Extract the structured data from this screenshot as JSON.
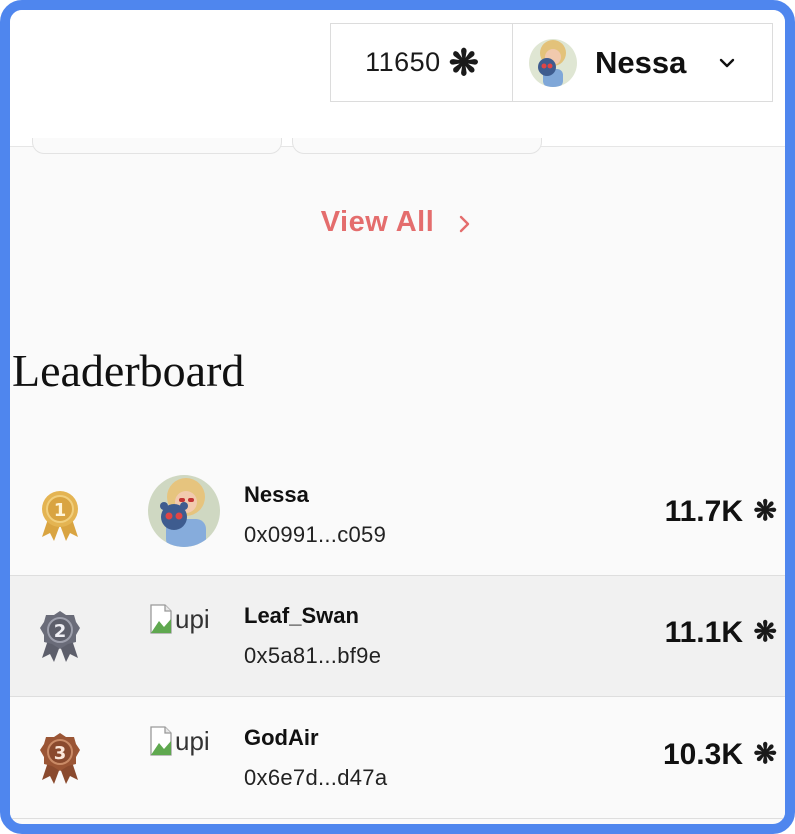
{
  "header": {
    "points": "11650",
    "points_icon": "asterisk-flower-icon",
    "user_name": "Nessa",
    "dropdown_icon": "chevron-down-icon"
  },
  "view_all": {
    "label": "View All",
    "icon": "chevron-right-icon",
    "color": "#e46d6d"
  },
  "leaderboard": {
    "title": "Leaderboard",
    "rows": [
      {
        "rank_icon": "gold-medal-1-icon",
        "name": "Nessa",
        "address": "0x0991...c059",
        "score": "11.7K",
        "avatar": "photo-avatar"
      },
      {
        "rank_icon": "silver-medal-2-icon",
        "name": "Leaf_Swan",
        "address": "0x5a81...bf9e",
        "score": "11.1K",
        "avatar": "broken-image",
        "avatar_alt": "upi"
      },
      {
        "rank_icon": "bronze-medal-3-icon",
        "name": "GodAir",
        "address": "0x6e7d...d47a",
        "score": "10.3K",
        "avatar": "broken-image",
        "avatar_alt": "upi"
      }
    ]
  },
  "colors": {
    "frame": "#4f86ee",
    "gold": "#d9a441",
    "silver": "#5d5f6b",
    "bronze": "#8a4a2e"
  }
}
